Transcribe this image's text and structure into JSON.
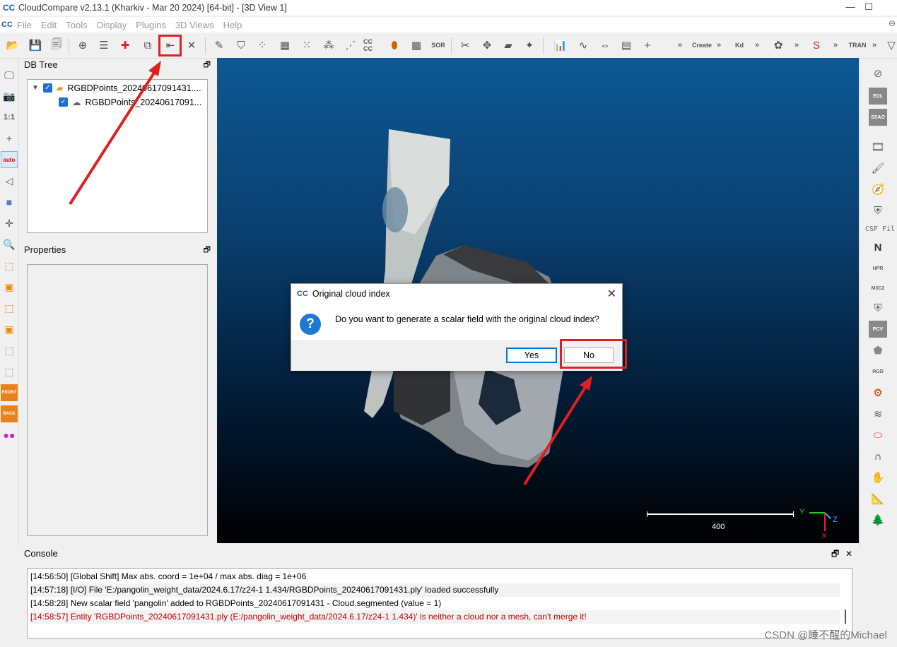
{
  "window": {
    "title": "CloudCompare v2.13.1 (Kharkiv - Mar 20 2024) [64-bit] - [3D View 1]",
    "minimize": "—",
    "maximize": "☐"
  },
  "menu": {
    "items": [
      "File",
      "Edit",
      "Tools",
      "Display",
      "Plugins",
      "3D Views",
      "Help"
    ],
    "right_glyph": "⊖"
  },
  "toolbar": {
    "csf_label": "CSF Fil",
    "sor_label": "SOR",
    "kd_label": "Kd",
    "create_label": "Create",
    "ccc_label": "CC CC",
    "tran_label": "TRAN"
  },
  "leftbar": {
    "ratio_label": "1:1",
    "auto_label": "auto",
    "front_label": "FRONT",
    "back_label": "BACK"
  },
  "rightbar": {
    "edl_label": "EDL",
    "ssao_label": "SSAO",
    "n_label": "N",
    "hpr_label": "HPR",
    "m3c2_label": "M3C2",
    "pcv_label": "PCV",
    "rgd_label": "RGD"
  },
  "db_tree": {
    "header": "DB Tree",
    "items": [
      {
        "label": "RGBDPoints_20240617091431...."
      },
      {
        "label": "RGBDPoints_20240617091..."
      }
    ]
  },
  "properties": {
    "header": "Properties"
  },
  "view": {
    "scale_value": "400",
    "axis_x": "X",
    "axis_y": "Y",
    "axis_z": "Z"
  },
  "dialog": {
    "title": "Original cloud index",
    "message": "Do you want to generate a scalar field with the original cloud index?",
    "yes": "Yes",
    "no": "No",
    "close": "✕"
  },
  "console": {
    "header": "Console",
    "lines": [
      "[14:56:50] [Global Shift] Max abs. coord = 1e+04 / max abs. diag = 1e+06",
      "[14:57:18] [I/O] File 'E:/pangolin_weight_data/2024.6.17/z24-1 1.434/RGBDPoints_20240617091431.ply' loaded successfully",
      "[14:58:28] New scalar field 'pangolin' added to RGBDPoints_20240617091431 - Cloud.segmented (value = 1)",
      "[14:58:57] Entity 'RGBDPoints_20240617091431.ply (E:/pangolin_weight_data/2024.6.17/z24-1 1.434)' is neither a cloud nor a mesh, can't merge it!"
    ]
  },
  "watermark": "CSDN @睡不醒的Michael",
  "colors": {
    "highlight": "#e02020",
    "accent": "#1e78d2",
    "error_text": "#c00000"
  }
}
